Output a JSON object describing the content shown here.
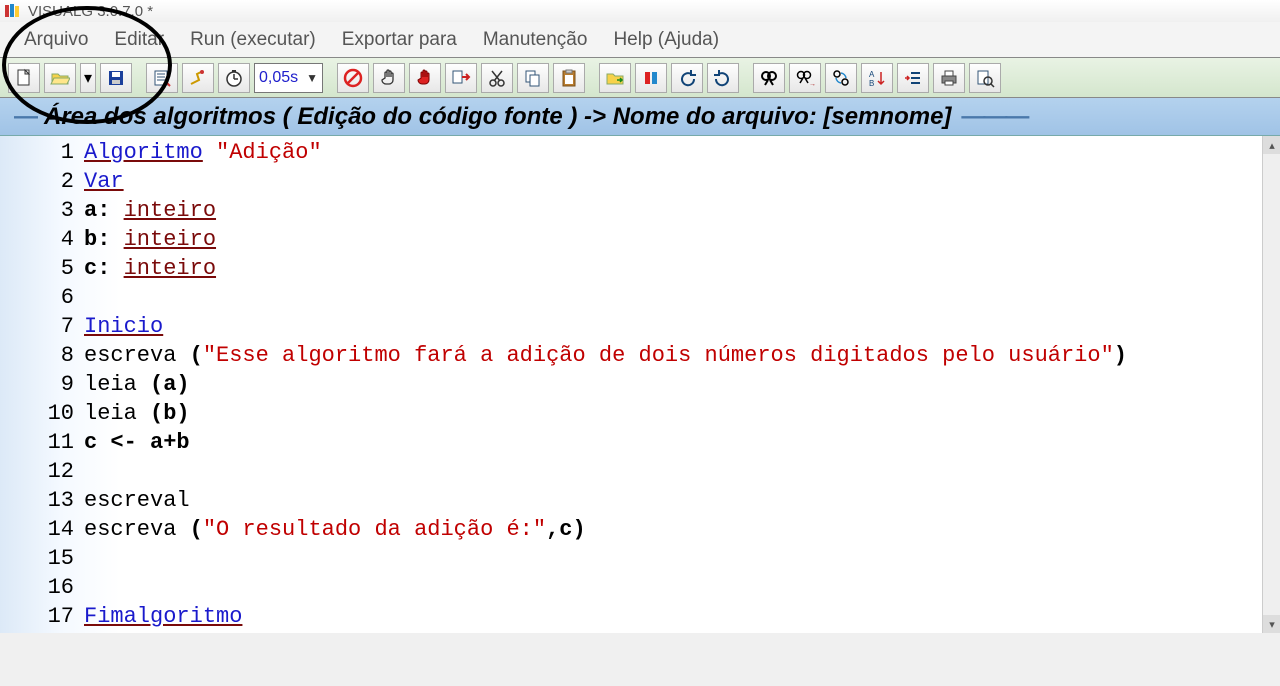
{
  "window": {
    "title": "VISUALG 3.0.7.0 *"
  },
  "menu": {
    "arquivo": "Arquivo",
    "editar": "Editar",
    "run": "Run (executar)",
    "exportar": "Exportar para",
    "manutencao": "Manutenção",
    "help": "Help (Ajuda)"
  },
  "toolbar": {
    "speed": "0,05s"
  },
  "banner": {
    "text": "Área dos algoritmos ( Edição do código fonte ) -> Nome do arquivo: [semnome]"
  },
  "code": {
    "lines": [
      {
        "n": "1",
        "segments": [
          {
            "t": "Algoritmo",
            "c": "kw"
          },
          {
            "t": " ",
            "c": "fn"
          },
          {
            "t": "\"Adição\"",
            "c": "str"
          }
        ]
      },
      {
        "n": "2",
        "segments": [
          {
            "t": "Var",
            "c": "kw"
          }
        ]
      },
      {
        "n": "3",
        "segments": [
          {
            "t": "a: ",
            "c": "blk"
          },
          {
            "t": "inteiro",
            "c": "ty"
          }
        ]
      },
      {
        "n": "4",
        "segments": [
          {
            "t": "b: ",
            "c": "blk"
          },
          {
            "t": "inteiro",
            "c": "ty"
          }
        ]
      },
      {
        "n": "5",
        "segments": [
          {
            "t": "c: ",
            "c": "blk"
          },
          {
            "t": "inteiro",
            "c": "ty"
          }
        ]
      },
      {
        "n": "6",
        "segments": []
      },
      {
        "n": "7",
        "segments": [
          {
            "t": "Inicio",
            "c": "kw"
          }
        ]
      },
      {
        "n": "8",
        "segments": [
          {
            "t": "escreva ",
            "c": "fn"
          },
          {
            "t": "(",
            "c": "blk"
          },
          {
            "t": "\"Esse algoritmo fará a adição de dois números digitados pelo usuário\"",
            "c": "str"
          },
          {
            "t": ")",
            "c": "blk"
          }
        ]
      },
      {
        "n": "9",
        "segments": [
          {
            "t": "leia ",
            "c": "fn"
          },
          {
            "t": "(a)",
            "c": "blk"
          }
        ]
      },
      {
        "n": "10",
        "segments": [
          {
            "t": "leia ",
            "c": "fn"
          },
          {
            "t": "(b)",
            "c": "blk"
          }
        ]
      },
      {
        "n": "11",
        "segments": [
          {
            "t": "c <- a+b",
            "c": "blk"
          }
        ]
      },
      {
        "n": "12",
        "segments": []
      },
      {
        "n": "13",
        "segments": [
          {
            "t": "escreval",
            "c": "fn"
          }
        ]
      },
      {
        "n": "14",
        "segments": [
          {
            "t": "escreva ",
            "c": "fn"
          },
          {
            "t": "(",
            "c": "blk"
          },
          {
            "t": "\"O resultado da adição é:\"",
            "c": "str"
          },
          {
            "t": ",c",
            "c": "blk"
          },
          {
            "t": ")",
            "c": "blk"
          }
        ]
      },
      {
        "n": "15",
        "segments": []
      },
      {
        "n": "16",
        "segments": []
      },
      {
        "n": "17",
        "segments": [
          {
            "t": "Fimalgoritmo",
            "c": "kw"
          }
        ]
      }
    ]
  }
}
